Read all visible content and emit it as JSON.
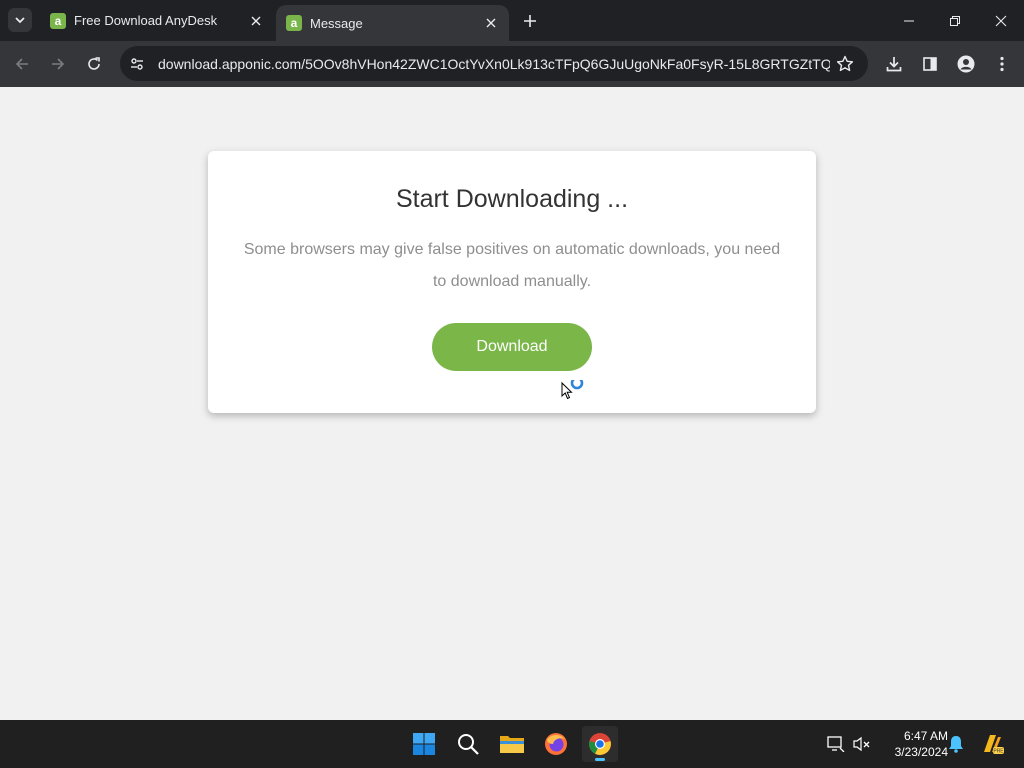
{
  "browser": {
    "tabs": [
      {
        "favicon": "a",
        "title": "Free Download AnyDesk",
        "active": false
      },
      {
        "favicon": "a",
        "title": "Message",
        "active": true
      }
    ],
    "url": "download.apponic.com/5OOv8hVHon42ZWC1OctYvXn0Lk913cTFpQ6GJuUgoNkFa0FsyR-15L8GRTGZtTQ7j..."
  },
  "page": {
    "title": "Start Downloading ...",
    "message": "Some browsers may give false positives on automatic downloads, you need to download manually.",
    "download_button": "Download"
  },
  "taskbar": {
    "time": "6:47 AM",
    "date": "3/23/2024",
    "apps": [
      "start-icon",
      "search-icon",
      "file-explorer-icon",
      "firefox-icon",
      "chrome-icon"
    ]
  },
  "colors": {
    "accent_green": "#7ab648",
    "favicon_green": "#79b54a",
    "chrome_dark": "#202124",
    "toolbar": "#35363a"
  }
}
